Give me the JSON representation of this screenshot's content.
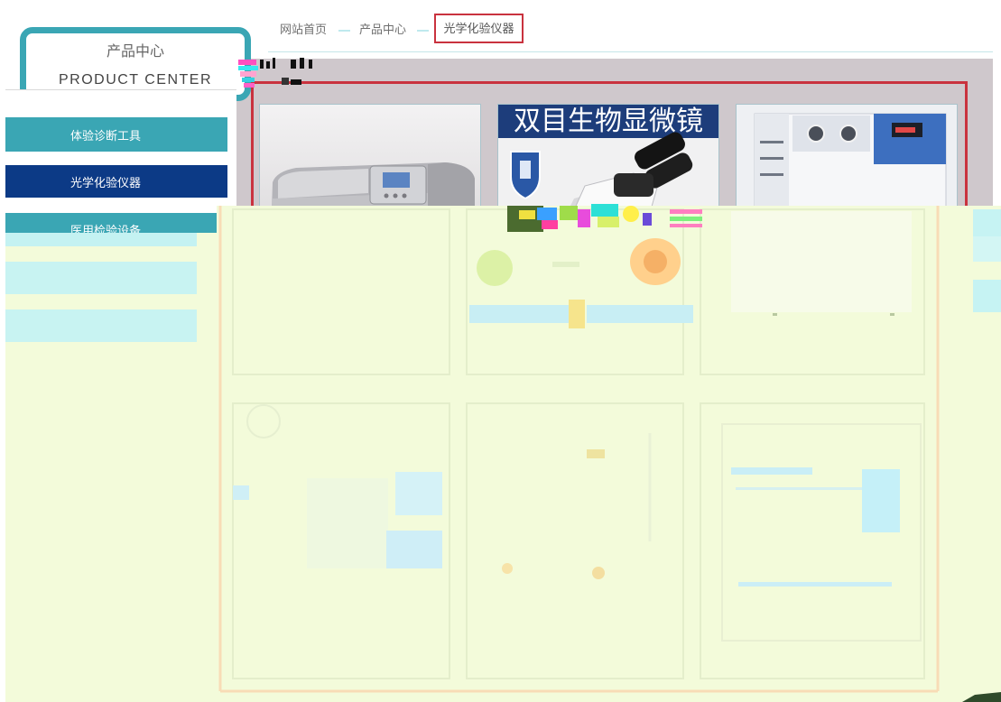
{
  "breadcrumb": {
    "home": "网站首页",
    "section": "产品中心",
    "current": "光学化验仪器"
  },
  "category_header": {
    "title": "产品中心",
    "subtitle": "PRODUCT CENTER"
  },
  "sidebar": {
    "items": [
      {
        "label": "体验诊断工具",
        "active": false
      },
      {
        "label": "光学化验仪器",
        "active": true
      },
      {
        "label": "医用检验设备",
        "active": false
      },
      {
        "label": "",
        "active": false
      },
      {
        "label": "",
        "active": false
      }
    ]
  },
  "products": [
    {
      "icon": "spectrophotometer-icon"
    },
    {
      "icon": "microscope-icon",
      "banner": "双目生物显微镜"
    },
    {
      "icon": "lab-cabinet-icon"
    }
  ],
  "colors": {
    "accent": "#3aa6b4",
    "active": "#0c3a86",
    "highlight_border": "#c9323e",
    "panel_bg": "#cfc8cc",
    "overlay_bg": "#f3fbda"
  }
}
